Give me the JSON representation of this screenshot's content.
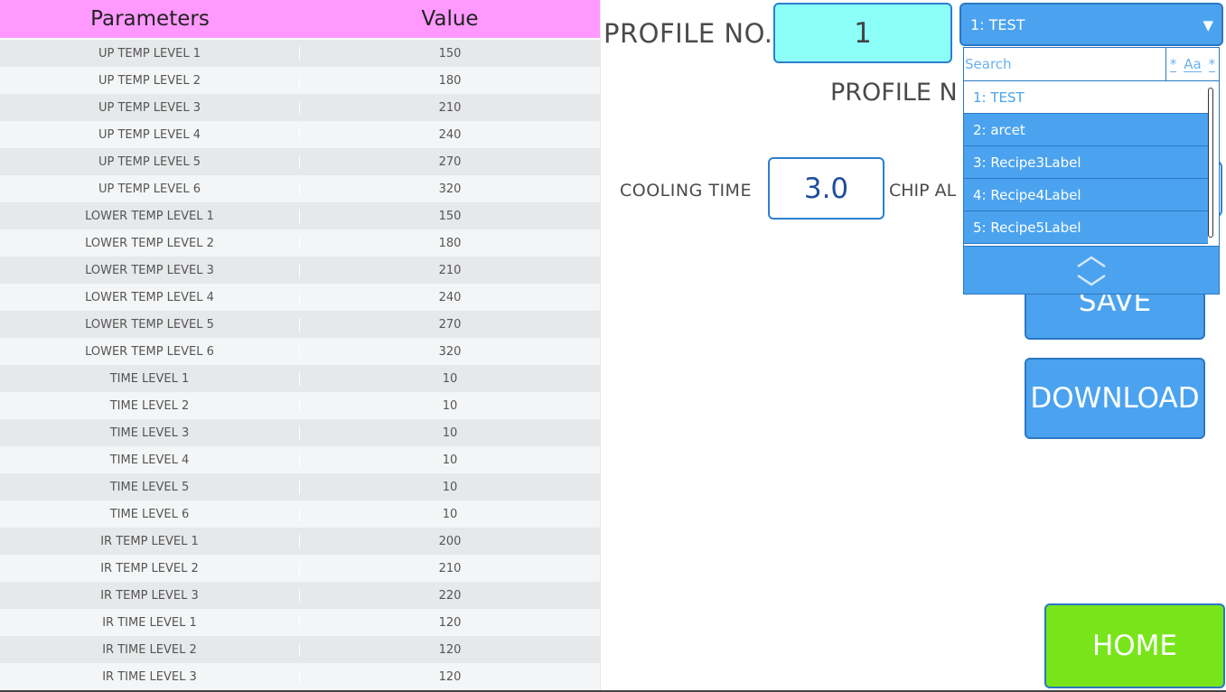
{
  "table": {
    "headers": {
      "param": "Parameters",
      "value": "Value"
    },
    "rows": [
      {
        "param": "UP TEMP LEVEL 1",
        "value": "150"
      },
      {
        "param": "UP TEMP LEVEL 2",
        "value": "180"
      },
      {
        "param": "UP TEMP LEVEL 3",
        "value": "210"
      },
      {
        "param": "UP TEMP LEVEL 4",
        "value": "240"
      },
      {
        "param": "UP TEMP LEVEL 5",
        "value": "270"
      },
      {
        "param": "UP TEMP LEVEL 6",
        "value": "320"
      },
      {
        "param": "LOWER TEMP LEVEL 1",
        "value": "150"
      },
      {
        "param": "LOWER TEMP LEVEL 2",
        "value": "180"
      },
      {
        "param": "LOWER TEMP LEVEL 3",
        "value": "210"
      },
      {
        "param": "LOWER TEMP LEVEL 4",
        "value": "240"
      },
      {
        "param": "LOWER TEMP LEVEL 5",
        "value": "270"
      },
      {
        "param": "LOWER TEMP LEVEL 6",
        "value": "320"
      },
      {
        "param": "TIME LEVEL 1",
        "value": "10"
      },
      {
        "param": "TIME LEVEL 2",
        "value": "10"
      },
      {
        "param": "TIME LEVEL 3",
        "value": "10"
      },
      {
        "param": "TIME LEVEL 4",
        "value": "10"
      },
      {
        "param": "TIME LEVEL 5",
        "value": "10"
      },
      {
        "param": "TIME LEVEL 6",
        "value": "10"
      },
      {
        "param": "IR TEMP LEVEL 1",
        "value": "200"
      },
      {
        "param": "IR TEMP LEVEL 2",
        "value": "210"
      },
      {
        "param": "IR TEMP LEVEL 3",
        "value": "220"
      },
      {
        "param": "IR TIME LEVEL 1",
        "value": "120"
      },
      {
        "param": "IR TIME LEVEL 2",
        "value": "120"
      },
      {
        "param": "IR TIME LEVEL 3",
        "value": "120"
      }
    ]
  },
  "profile": {
    "no_label": "PROFILE NO.",
    "no_value": "1",
    "name_label": "PROFILE N"
  },
  "cooling": {
    "label": "COOLING TIME",
    "value": "3.0"
  },
  "chip": {
    "label": "CHIP AL"
  },
  "dropdown": {
    "selected": "1: TEST",
    "arrow": "▼",
    "search_placeholder": "Search",
    "options_flags": [
      "*",
      "Aa",
      "*"
    ],
    "items": [
      "1: TEST",
      "2: arcet",
      "3: Recipe3Label",
      "4: Recipe4Label",
      "5: Recipe5Label"
    ],
    "nav_icon": "chevron-up-down-icon"
  },
  "buttons": {
    "save": "SAVE",
    "download": "DOWNLOAD",
    "home": "HOME"
  },
  "colors": {
    "header_pink": "#ff99ff",
    "profile_cyan": "#8cfff8",
    "button_blue": "#4ba3ef",
    "home_green": "#77e51a"
  }
}
